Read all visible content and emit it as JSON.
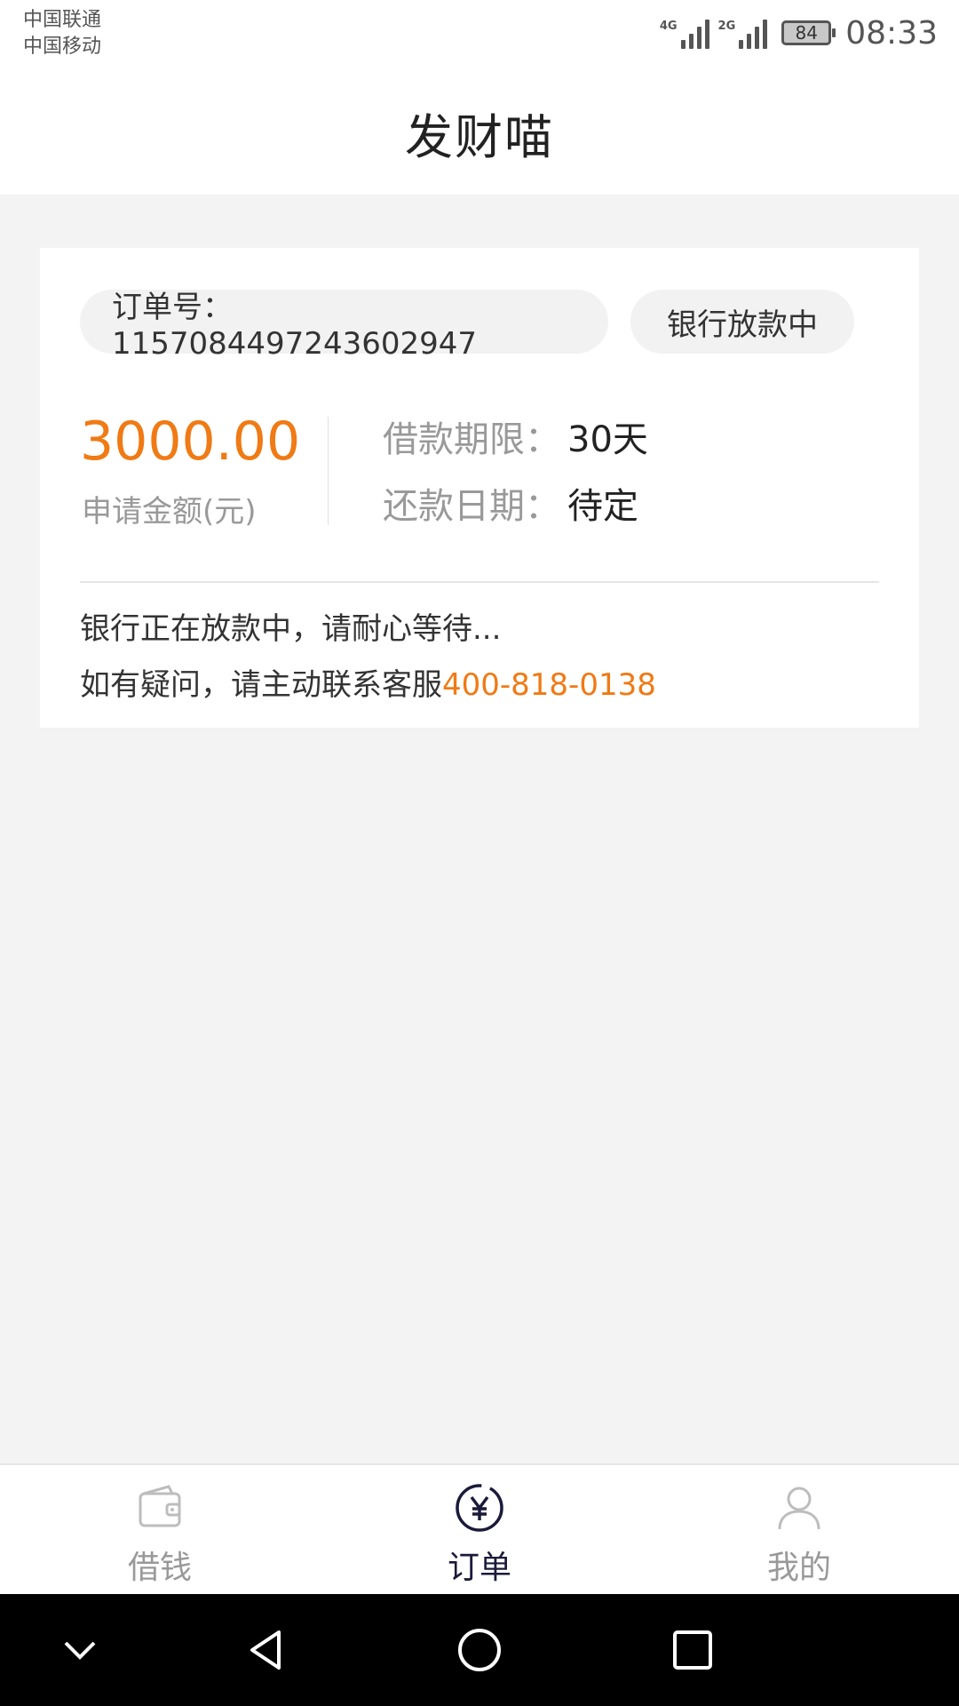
{
  "status_bar": {
    "carrier1": "中国联通",
    "carrier2": "中国移动",
    "net1": "4G",
    "net2": "2G",
    "battery": "84",
    "time": "08:33"
  },
  "header": {
    "title": "发财喵"
  },
  "order": {
    "number_label": "订单号：1157084497243602947",
    "status": "银行放款中",
    "amount": "3000.00",
    "amount_label": "申请金额(元)",
    "term_key": "借款期限：",
    "term_value": "30天",
    "repay_key": "还款日期：",
    "repay_value": "待定",
    "note_line1": "银行正在放款中，请耐心等待...",
    "note_line2_prefix": "如有疑问，请主动联系客服",
    "phone": "400-818-0138"
  },
  "bottom_nav": {
    "items": [
      {
        "label": "借钱",
        "icon": "wallet-icon",
        "active": false
      },
      {
        "label": "订单",
        "icon": "yen-circle-icon",
        "active": true
      },
      {
        "label": "我的",
        "icon": "user-icon",
        "active": false
      }
    ]
  },
  "system_nav": [
    "chevron-down-icon",
    "back-triangle-icon",
    "home-circle-icon",
    "recent-square-icon"
  ],
  "colors": {
    "accent": "#f07a14",
    "active_nav": "#1a1a3a",
    "background": "#f3f3f3"
  }
}
